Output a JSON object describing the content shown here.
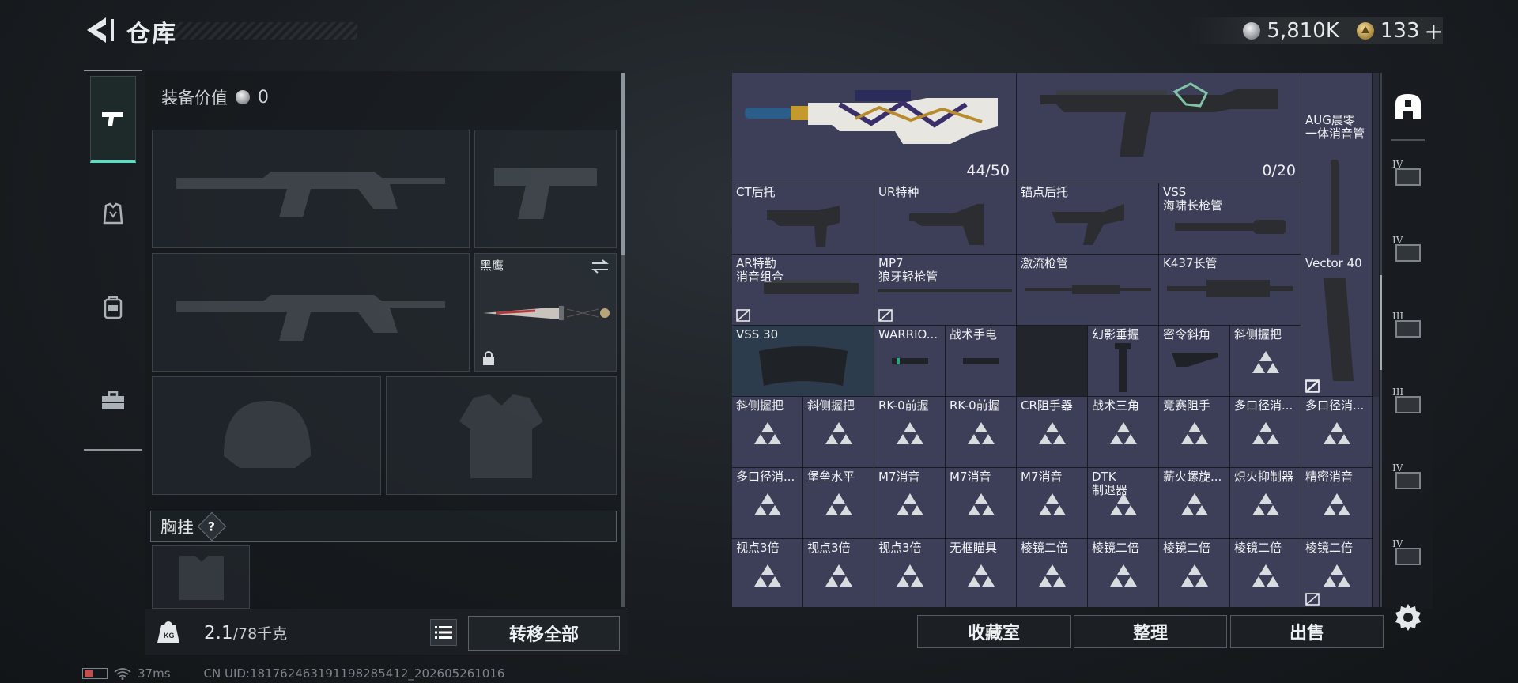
{
  "header": {
    "title": "仓库",
    "currency": {
      "silver": "5,810K",
      "gold": "133"
    },
    "gold_plus": "+"
  },
  "equipment": {
    "value_label": "装备价值",
    "value": "0",
    "melee_slot_label": "黑鹰",
    "chest_rig_label": "胸挂",
    "help_glyph": "?"
  },
  "weight": {
    "current": "2.1",
    "max": "/78千克"
  },
  "buttons": {
    "transfer_all": "转移全部",
    "collection_room": "收藏室",
    "organize": "整理",
    "sell": "出售"
  },
  "status": {
    "ping": "37ms",
    "uid": "CN UID:18176246319119828541​2_202605261016"
  },
  "storage": {
    "rifle_count": "44/50",
    "smg_count": "0/20",
    "aug_label": "AUG晨零\n一体消音管",
    "row1": [
      "CT后托",
      "UR特种",
      "锚点后托",
      "VSS\n海啸长枪管"
    ],
    "row2": [
      "AR特勤\n消音组合",
      "MP7\n狼牙轻枪管",
      "激流枪管",
      "K437长管",
      "Vector 40"
    ],
    "row3": [
      "VSS 30",
      "WARRIO...",
      "战术手电",
      "",
      "幻影垂握",
      "密令斜角",
      "斜侧握把"
    ],
    "row4": [
      "斜侧握把",
      "斜侧握把",
      "RK-0前握",
      "RK-0前握",
      "CR阻手器",
      "战术三角",
      "竞赛阻手",
      "多口径消...",
      "多口径消..."
    ],
    "row5": [
      "多口径消...",
      "堡垒水平",
      "M7消音",
      "M7消音",
      "M7消音",
      "DTK\n制退器",
      "薪火螺旋...",
      "炽火抑制器",
      "精密消音"
    ],
    "row6": [
      "视点3倍",
      "视点3倍",
      "视点3倍",
      "无框瞄具",
      "棱镜二倍",
      "棱镜二倍",
      "棱镜二倍",
      "棱镜二倍",
      "棱镜二倍"
    ]
  },
  "sidebar": {
    "tiers": [
      "IV",
      "IV",
      "III",
      "III",
      "IV",
      "IV"
    ]
  },
  "colors": {
    "accent": "#57e0c8",
    "cell_purple": "#3d3f58",
    "cell_blue": "#2c3c4c"
  }
}
